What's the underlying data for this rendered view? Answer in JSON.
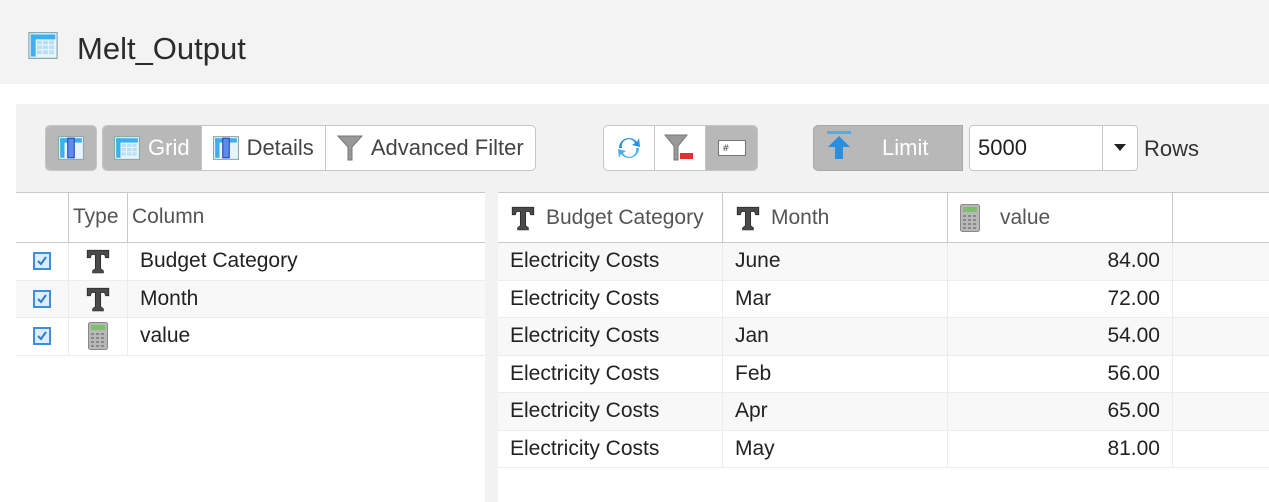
{
  "title": "Melt_Output",
  "toolbar": {
    "view_toggle_icon": "column-view-icon",
    "view_tabs": [
      {
        "label": "Grid",
        "icon": "grid-icon",
        "active": true
      },
      {
        "label": "Details",
        "icon": "details-icon",
        "active": false
      },
      {
        "label": "Advanced Filter",
        "icon": "filter-icon",
        "active": false
      }
    ],
    "actions": [
      {
        "icon": "refresh-icon"
      },
      {
        "icon": "clear-filter-icon"
      },
      {
        "icon": "row-number-icon",
        "active": true
      }
    ],
    "limit_label": "Limit",
    "limit_value": "5000",
    "rows_label": "Rows"
  },
  "columns_panel": {
    "headers": {
      "check": "",
      "type": "Type",
      "column": "Column"
    },
    "rows": [
      {
        "checked": true,
        "type": "text",
        "name": "Budget Category"
      },
      {
        "checked": true,
        "type": "numeric",
        "name": "Month"
      },
      {
        "checked": true,
        "type": "numeric",
        "name": "value"
      }
    ]
  },
  "grid": {
    "headers": [
      {
        "label": "Budget Category",
        "type": "text"
      },
      {
        "label": "Month",
        "type": "text"
      },
      {
        "label": "value",
        "type": "numeric"
      }
    ],
    "rows": [
      [
        "Electricity Costs",
        "June",
        "84.00"
      ],
      [
        "Electricity Costs",
        "Mar",
        "72.00"
      ],
      [
        "Electricity Costs",
        "Jan",
        "54.00"
      ],
      [
        "Electricity Costs",
        "Feb",
        "56.00"
      ],
      [
        "Electricity Costs",
        "Apr",
        "65.00"
      ],
      [
        "Electricity Costs",
        "May",
        "81.00"
      ]
    ]
  }
}
